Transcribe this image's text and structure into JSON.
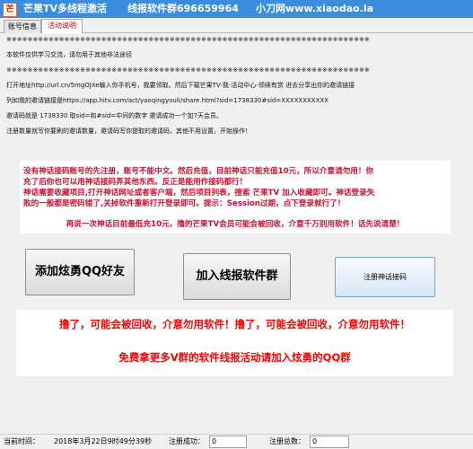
{
  "window": {
    "icon_text": "芒",
    "title": "芒果TV多线程激活      线报软件群696659964     小刀网www.xiaodao.la"
  },
  "tabs": [
    {
      "label": "账号信息",
      "active": false
    },
    {
      "label": "活动说明",
      "active": true
    }
  ],
  "info_lines": [
    "※※※※※※※※※※※※※※※※※※※※※※※※※※※※※※※※※※※※※※※※※※※※※※※※※※※※※※※※※※※※※※※※※※※※※",
    "本软件仅供学习交流，请勿用于其他非法途径",
    "※※※※※※※※※※※※※※※※※※※※※※※※※※※※※※※※※※※※※※※※※※※※※※※※※※※※※※※※※※※※※※※※※※※※※",
    "打开地址http://url.cn/5mgOJXe输入你手机号，我要领取。然后下载芒果TV-我-活动中心-领续有赏  进去分享出你的邀请链接",
    "列如我的邀请链接是https://app.hitv.com/act/yaoqingyouli/share.html?sid=1738330#sid=XXXXXXXXXXX",
    "邀请码就是 1738330 取sid=和#sid=中间的数字  邀请成功一个加7天会员。",
    "注册数量就写你要刷的邀请数量，邀请码写你提取的邀请码，其他不用设置，开始操作！"
  ],
  "notice": {
    "lines": [
      "没有神话接码账号的先注册，账号不能中文。然后充值，目前神话只能充值10元，所以介意请勿用！你",
      "充了后你也可以用神话接码弄其他东西。反正是能用作接码都行！",
      "神话需要收藏项目,打开神话网址或者客户端，然后项目列表，搜索 芒果TV  加入收藏即可。神话登录失",
      "败的一般都是密码错了,关掉软件重新打开登录即可。提示：Session过期，点下登录就行了！"
    ],
    "warning": "再说一次神话目前最低充10元，撸的芒果TV会员可能会被回收，介意千万别用软件！话先说清楚！"
  },
  "buttons": {
    "add_qq": "添加炫勇QQ好友",
    "join_group": "加入线报软件群",
    "register": "注册神话接码"
  },
  "warnings": {
    "recycle": "撸了，可能会被回收，介意勿用软件！撸了，可能会被回收，介意勿用软件！",
    "promo": "免费拿更多V群的软件线报活动请加入炫勇的QQ群"
  },
  "status": {
    "time_label": "当前时间：",
    "time_value": "2018年3月22日9时49分39秒",
    "success_label": "注册成功：",
    "success_value": "0",
    "total_label": "注册总数：",
    "total_value": "0"
  },
  "colors": {
    "titlebar": "#3b8de0",
    "notice_text": "#c8102e",
    "warning_text": "#ff0000"
  }
}
